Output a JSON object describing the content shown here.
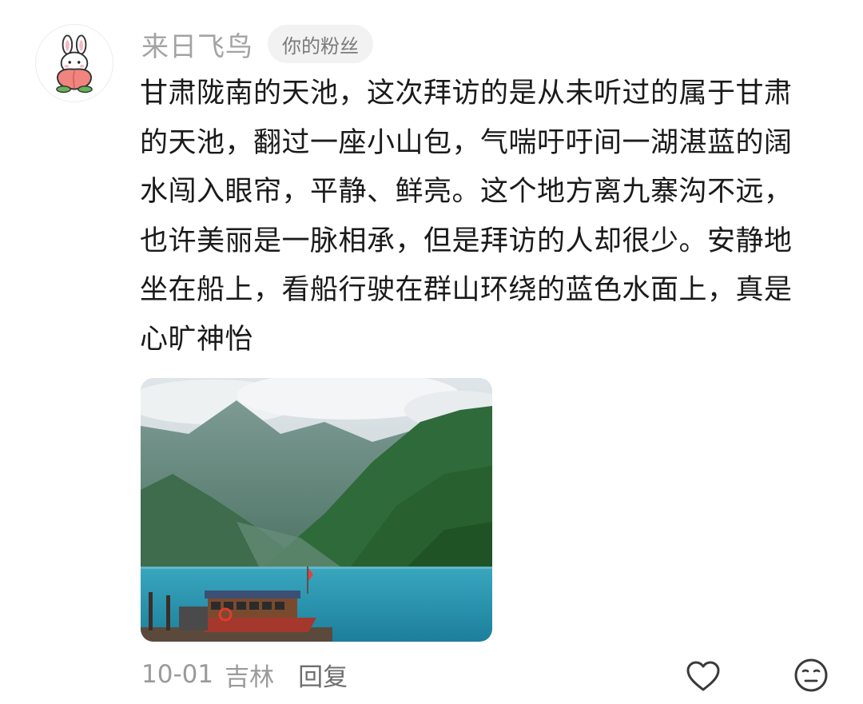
{
  "comment": {
    "username": "来日飞鸟",
    "badge": "你的粉丝",
    "text": "甘肃陇南的天池，这次拜访的是从未听过的属于甘肃的天池，翻过一座小山包，气喘吁吁间一湖湛蓝的阔水闯入眼帘，平静、鲜亮。这个地方离九寨沟不远，也许美丽是一脉相承，但是拜访的人却很少。安静地坐在船上，看船行驶在群山环绕的蓝色水面上，真是心旷神怡",
    "date": "10-01",
    "location": "吉林",
    "reply_label": "回复"
  },
  "icons": {
    "avatar": "bunny-peach-avatar",
    "like": "heart-icon",
    "emoji": "emoji-face-icon"
  },
  "colors": {
    "username": "#a3a3a3",
    "badge_bg": "#f2f2f2",
    "meta": "#9a9a9a",
    "lake": "#2a93ad"
  }
}
